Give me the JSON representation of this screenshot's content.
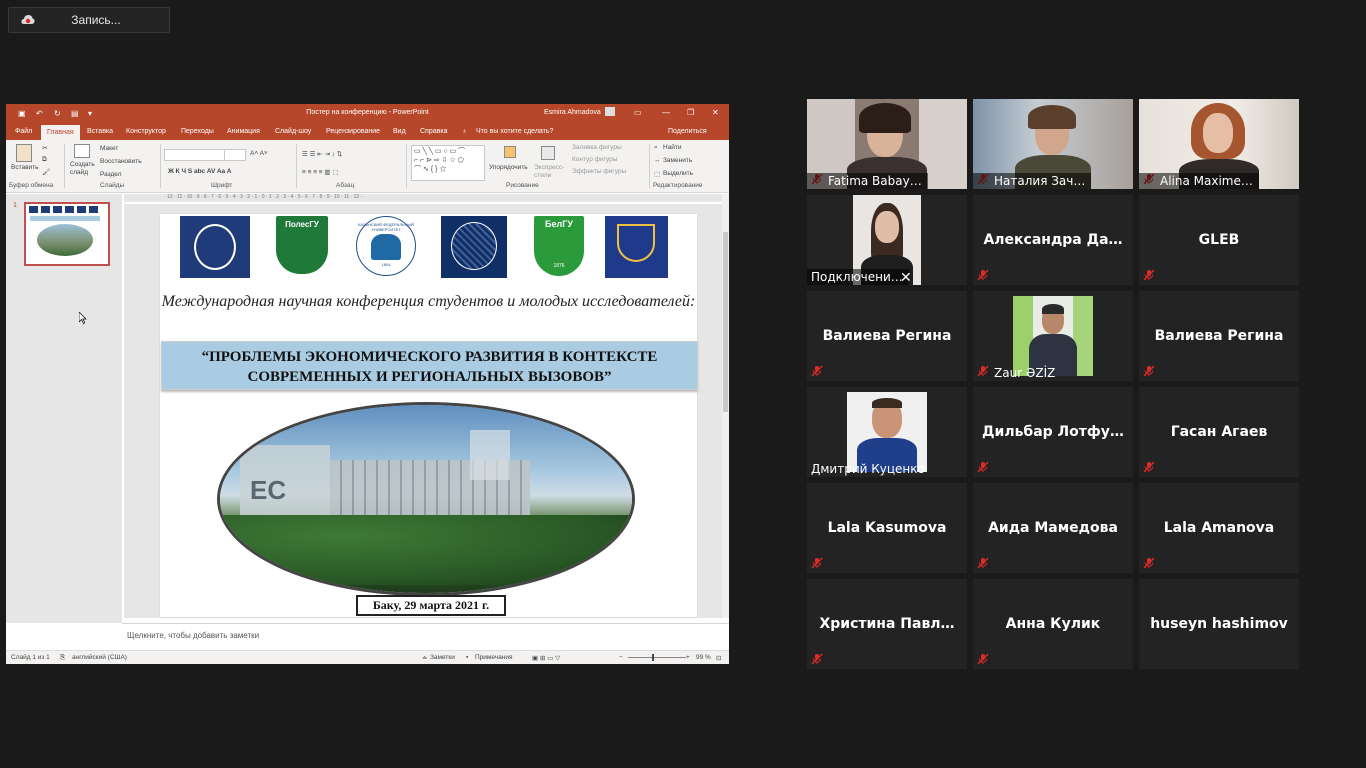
{
  "recording": {
    "label": "Запись..."
  },
  "powerpoint": {
    "title": "Постер на конференцию  -  PowerPoint",
    "user": "Esmira Ahmadova",
    "tabs": [
      "Файл",
      "Главная",
      "Вставка",
      "Конструктор",
      "Переходы",
      "Анимация",
      "Слайд-шоу",
      "Рецензирование",
      "Вид",
      "Справка",
      "Что вы хотите сделать?"
    ],
    "share": "Поделиться",
    "ribbon": {
      "paste": "Вставить",
      "create_slide": "Создать слайд",
      "layout": "Макет",
      "reset": "Восстановить",
      "section": "Раздел",
      "arrange": "Упорядочить",
      "express_styles": "Экспресс-стили",
      "shape_fill": "Заливка фигуры",
      "shape_outline": "Контур фигуры",
      "shape_effects": "Эффекты фигуры",
      "find": "Найти",
      "replace": "Заменить",
      "select": "Выделить",
      "groups": [
        "Буфер обмена",
        "Слайды",
        "Шрифт",
        "Абзац",
        "Рисование",
        "Редактирование"
      ]
    },
    "slide": {
      "number": "1",
      "logos": [
        "ПолесГУ",
        "КАЗАНСКИЙ ФЕДЕРАЛЬНЫЙ УНИВЕРСИТЕТ",
        "БелГУ"
      ],
      "logo_year_kazan": "1804",
      "logo_year_belgu": "1876",
      "heading": "Международная научная конференция студентов и молодых исследователей:",
      "title": "“ПРОБЛЕМЫ ЭКОНОМИЧЕСКОГО РАЗВИТИЯ В КОНТЕКСТЕ СОВРЕМЕННЫХ И РЕГИОНАЛЬНЫХ ВЫЗОВОВ”",
      "building_sign": "EC",
      "date": "Баку, 29 марта 2021 г."
    },
    "notes_placeholder": "Щелкните, чтобы добавить заметки",
    "status": {
      "slide": "Слайд 1 из 1",
      "language": "английский (США)",
      "notes": "Заметки",
      "comments": "Примечания",
      "zoom": "99 %"
    }
  },
  "participants": [
    {
      "name": "Fatima Babay…",
      "video": true
    },
    {
      "name": "Наталия Зач…",
      "video": true
    },
    {
      "name": "Alina Maxime…",
      "video": true
    },
    {
      "name": "Подключени…",
      "video": true
    },
    {
      "name": "Александра  Да…",
      "video": false
    },
    {
      "name": "GLEB",
      "video": false
    },
    {
      "name": "Валиева Регина",
      "video": false
    },
    {
      "name": "Zaur ƏZİZ",
      "video": true
    },
    {
      "name": "Валиева Регина",
      "video": false
    },
    {
      "name": "Дмитрий Куценко",
      "video": true
    },
    {
      "name": "Дильбар  Лотфу…",
      "video": false
    },
    {
      "name": "Гасан Агаев",
      "video": false
    },
    {
      "name": "Lala Kasumova",
      "video": false
    },
    {
      "name": "Аида Мамедова",
      "video": false
    },
    {
      "name": "Lala Amanova",
      "video": false
    },
    {
      "name": "Христина  Павл…",
      "video": false
    },
    {
      "name": "Анна Кулик",
      "video": false
    },
    {
      "name": "huseyn hashimov",
      "video": false
    }
  ],
  "colors": {
    "ppt_accent": "#b7472a",
    "mic_muted": "#e02828",
    "background": "#1a1a1a"
  }
}
